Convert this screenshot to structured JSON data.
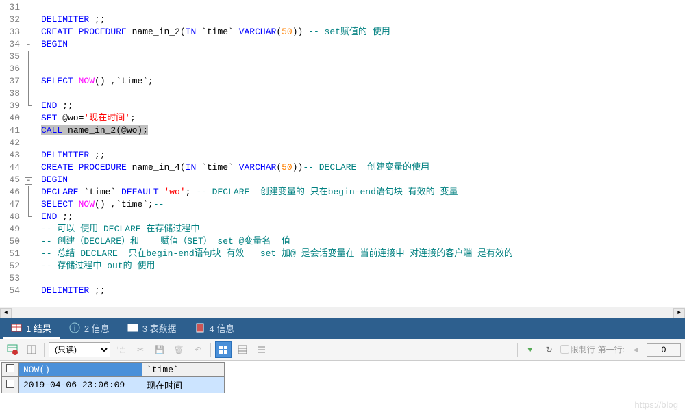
{
  "lines": [
    {
      "n": 31,
      "fold": "",
      "html": ""
    },
    {
      "n": 32,
      "fold": "",
      "html": "<span class='kw'>DELIMITER</span> ;;"
    },
    {
      "n": 33,
      "fold": "",
      "html": "<span class='kw'>CREATE</span> <span class='kw'>PROCEDURE</span> name_in_2(<span class='kw'>IN</span> `time` <span class='kw'>VARCHAR</span>(<span class='num'>50</span>)) <span class='cm'>-- set赋值的 使用</span>"
    },
    {
      "n": 34,
      "fold": "box",
      "html": "<span class='kw'>BEGIN</span>"
    },
    {
      "n": 35,
      "fold": "line",
      "html": ""
    },
    {
      "n": 36,
      "fold": "line",
      "html": ""
    },
    {
      "n": 37,
      "fold": "line",
      "html": "<span class='kw'>SELECT</span> <span class='func'>NOW</span>() ,`time`;"
    },
    {
      "n": 38,
      "fold": "line",
      "html": ""
    },
    {
      "n": 39,
      "fold": "end",
      "html": "<span class='kw'>END</span> ;;"
    },
    {
      "n": 40,
      "fold": "",
      "html": "<span class='kw'>SET</span> @wo=<span class='str'>'现在时间'</span>;"
    },
    {
      "n": 41,
      "fold": "",
      "html": "<span class='hl'><span class='kw'>CALL</span> name_in_2(@wo);</span>"
    },
    {
      "n": 42,
      "fold": "",
      "html": ""
    },
    {
      "n": 43,
      "fold": "",
      "html": "<span class='kw'>DELIMITER</span> ;;"
    },
    {
      "n": 44,
      "fold": "",
      "html": "<span class='kw'>CREATE</span> <span class='kw'>PROCEDURE</span> name_in_4(<span class='kw'>IN</span> `time` <span class='kw'>VARCHAR</span>(<span class='num'>50</span>))<span class='cm'>-- DECLARE  创建变量的使用</span>"
    },
    {
      "n": 45,
      "fold": "box",
      "html": "<span class='kw'>BEGIN</span>"
    },
    {
      "n": 46,
      "fold": "line",
      "html": "<span class='kw'>DECLARE</span> `time` <span class='kw'>DEFAULT</span> <span class='str'>'wo'</span>; <span class='cm'>-- DECLARE  创建变量的 只在begin-end语句块 有效的 变量</span>"
    },
    {
      "n": 47,
      "fold": "line",
      "html": "<span class='kw'>SELECT</span> <span class='func'>NOW</span>() ,`time`;<span class='cm'>--</span>"
    },
    {
      "n": 48,
      "fold": "end",
      "html": "<span class='kw'>END</span> ;;"
    },
    {
      "n": 49,
      "fold": "",
      "html": "<span class='cm'>-- 可以 使用 DECLARE 在存储过程中</span>"
    },
    {
      "n": 50,
      "fold": "",
      "html": "<span class='cm'>-- 创建（DECLARE）和    赋值（SET） set @变量名= 值</span>"
    },
    {
      "n": 51,
      "fold": "",
      "html": "<span class='cm'>-- 总结 DECLARE  只在begin-end语句块 有效   set 加@ 是会话变量在 当前连接中 对连接的客户端 是有效的</span>"
    },
    {
      "n": 52,
      "fold": "",
      "html": "<span class='cm'>-- 存储过程中 out的 使用</span>"
    },
    {
      "n": 53,
      "fold": "",
      "html": ""
    },
    {
      "n": 54,
      "fold": "",
      "html": "<span class='kw'>DELIMITER</span> ;;"
    }
  ],
  "tabs": [
    {
      "label": "1 结果",
      "active": true
    },
    {
      "label": "2 信息",
      "active": false
    },
    {
      "label": "3 表数据",
      "active": false
    },
    {
      "label": "4 信息",
      "active": false
    }
  ],
  "toolbar": {
    "mode": "(只读)",
    "limit_cb": "限制行",
    "first_row": "第一行:",
    "first_row_val": "0"
  },
  "result": {
    "headers": [
      "NOW()",
      "`time`"
    ],
    "rows": [
      [
        "2019-04-06 23:06:09",
        "现在时间"
      ]
    ]
  },
  "watermark": "https://blog"
}
